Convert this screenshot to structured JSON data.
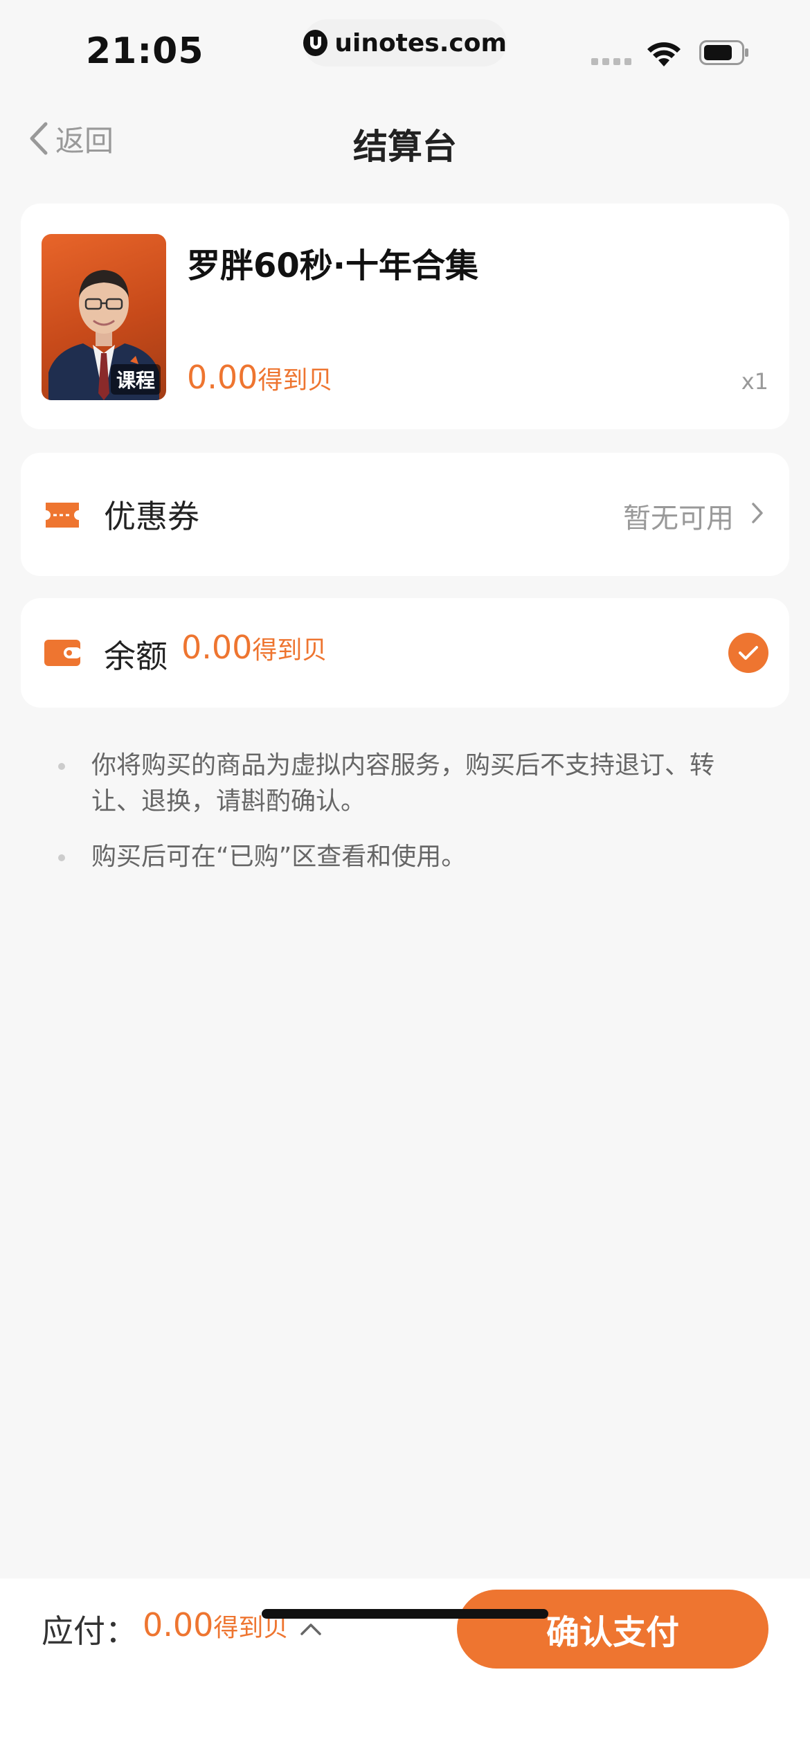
{
  "status_bar": {
    "time": "21:05",
    "url": "uinotes.com"
  },
  "nav": {
    "back_label": "返回",
    "title": "结算台"
  },
  "product": {
    "title": "罗胖60秒·十年合集",
    "badge": "课程",
    "price": "0.00",
    "price_unit": "得到贝",
    "quantity": "x1"
  },
  "coupon": {
    "label": "优惠券",
    "status": "暂无可用"
  },
  "balance": {
    "label": "余额",
    "amount": "0.00",
    "unit": "得到贝",
    "selected": true
  },
  "notes": [
    "你将购买的商品为虚拟内容服务，购买后不支持退订、转让、退换，请斟酌确认。",
    "购买后可在“已购”区查看和使用。"
  ],
  "footer": {
    "pay_label": "应付：",
    "pay_amount": "0.00",
    "pay_unit": "得到贝",
    "confirm_label": "确认支付"
  },
  "colors": {
    "accent": "#ee7530",
    "background": "#f7f7f7",
    "card": "#ffffff",
    "muted_text": "#999999"
  }
}
